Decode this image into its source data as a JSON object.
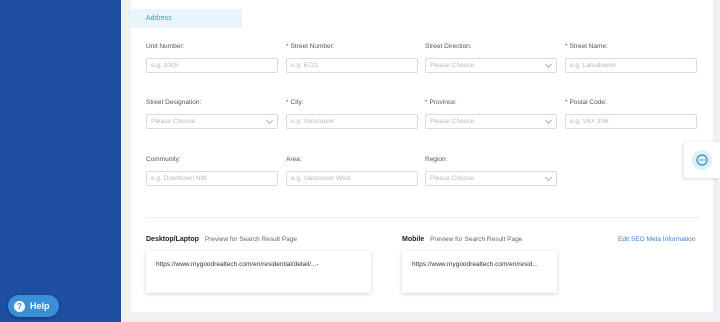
{
  "sidebar": {
    "help_label": "Help"
  },
  "section": {
    "tab_label": "Address"
  },
  "fields": [
    {
      "label": "Unit Number",
      "required": false,
      "placeholder": "e.g. 1005",
      "type": "text"
    },
    {
      "label": "Street Number",
      "required": true,
      "placeholder": "e.g. 6721",
      "type": "text"
    },
    {
      "label": "Street Direction",
      "required": false,
      "placeholder": "Please Choose",
      "type": "select"
    },
    {
      "label": "Street Name",
      "required": true,
      "placeholder": "e.g. Lansdowne",
      "type": "text"
    },
    {
      "label": "Street Designation",
      "required": false,
      "placeholder": "Please Choose",
      "type": "select"
    },
    {
      "label": "City",
      "required": true,
      "placeholder": "e.g. Vancouver",
      "type": "text"
    },
    {
      "label": "Province",
      "required": true,
      "placeholder": "Please Choose",
      "type": "select"
    },
    {
      "label": "Postal Code",
      "required": true,
      "placeholder": "e.g. V6X 3N6",
      "type": "text"
    },
    {
      "label": "Community",
      "required": false,
      "placeholder": "e.g. Downtown NW",
      "type": "text"
    },
    {
      "label": "Area",
      "required": false,
      "placeholder": "e.g. Vancouver West",
      "type": "text"
    },
    {
      "label": "Region",
      "required": false,
      "placeholder": "Please Choose",
      "type": "select"
    }
  ],
  "preview": {
    "desktop_title": "Desktop/Laptop",
    "desktop_sub": "Preview for Search Result Page",
    "desktop_url": "https://www.mygoodrealtech.com/en/residential/detail/...-",
    "mobile_title": "Mobile",
    "mobile_sub": "Preview for Search Result Page",
    "mobile_url": "https://www.mygoodrealtech.com/en/resid...",
    "seo_link": "Edit SEO Meta Information"
  },
  "icons": {
    "help": "help-icon",
    "chat": "chat-icon",
    "dropdown": "chevron-down-icon"
  },
  "colors": {
    "sidebar": "#1e4fa0",
    "accent": "#3aa0d8",
    "required": "#e0353f",
    "link": "#3a7bd5"
  }
}
